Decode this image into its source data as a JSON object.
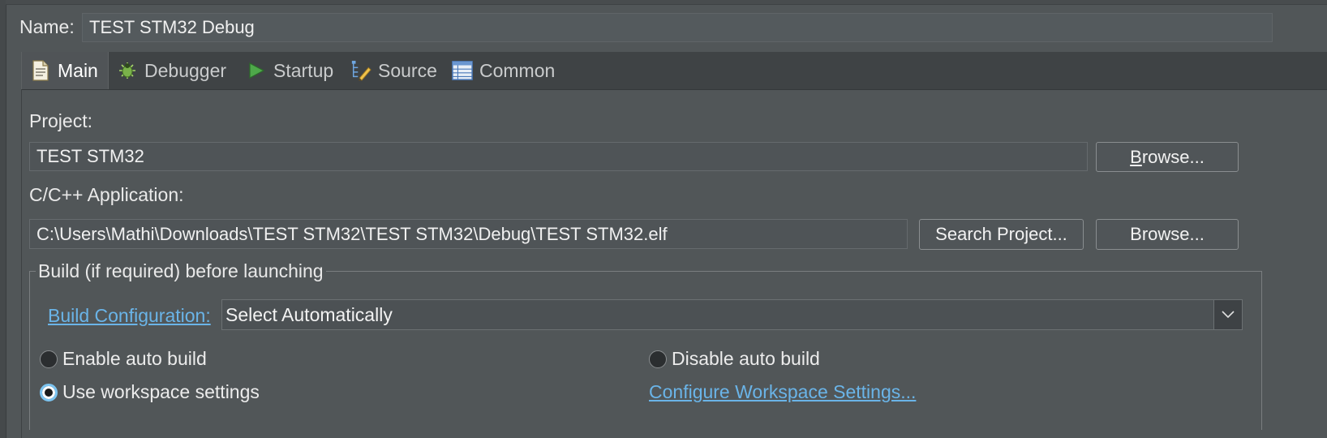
{
  "name_row": {
    "label": "Name:",
    "value": "TEST STM32 Debug"
  },
  "tabs": [
    {
      "label": "Main",
      "icon": "document-icon",
      "active": true
    },
    {
      "label": "Debugger",
      "icon": "bug-icon",
      "active": false
    },
    {
      "label": "Startup",
      "icon": "play-icon",
      "active": false
    },
    {
      "label": "Source",
      "icon": "source-edit-icon",
      "active": false
    },
    {
      "label": "Common",
      "icon": "table-icon",
      "active": false
    }
  ],
  "project": {
    "label": "Project:",
    "value": "TEST STM32",
    "browse_pre": "",
    "browse_mnemonic": "B",
    "browse_rest": "rowse..."
  },
  "application": {
    "label": "C/C++ Application:",
    "value": "C:\\Users\\Mathi\\Downloads\\TEST STM32\\TEST STM32\\Debug\\TEST STM32.elf",
    "search_label": "Search Project...",
    "browse_label": "Browse..."
  },
  "build": {
    "group_title": "Build (if required) before launching",
    "config_link": "Build Configuration:",
    "config_value": "Select Automatically",
    "enable_auto": "Enable auto build",
    "disable_auto": "Disable auto build",
    "use_workspace": "Use workspace settings",
    "selected": "Use workspace settings",
    "configure_link": "Configure Workspace Settings..."
  },
  "colors": {
    "background": "#515658",
    "link": "#6ab4e8",
    "radio_accent": "#7cc4f0"
  }
}
